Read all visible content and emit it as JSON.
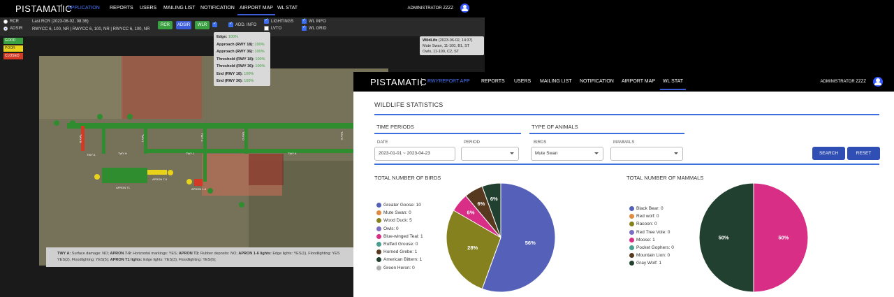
{
  "back_window": {
    "brand": "PISTAMATIC",
    "app_label": "APPLICATION",
    "nav": [
      "REPORTS",
      "USERS",
      "MAILING LIST",
      "NOTIFICATION",
      "AIRPORT MAP",
      "WL STAT"
    ],
    "active_nav": "AIRPORT MAP",
    "user": "ADMINISTRATOR ZZZZ",
    "controls": {
      "radio_rcr": "RCR",
      "radio_adsir": "ADSIR",
      "radio_selected": "ADSIR",
      "last_rcr": "Last RCR (2023-06-02, 08:36)",
      "rwycc": "RWYCC 6, 100, NR | RWYCC 6, 100, NR | RWYCC 6, 100, NR",
      "btn_rcr": "RCR",
      "btn_adsir": "ADSIR",
      "btn_wlr": "WLR",
      "add_info": "ADD. INFO",
      "lightings": "LIGHTINGS",
      "lvto": "LVTO",
      "wl_info": "WL INFO",
      "wl_grid": "WL GRID"
    },
    "legend": {
      "good": "GOOD",
      "poor": "POOR",
      "closed": "CLOSED"
    },
    "runway_popup": [
      {
        "label": "Edge:",
        "value": "100%"
      },
      {
        "label": "Approach (RWY 18):",
        "value": "100%"
      },
      {
        "label": "Approach (RWY 36):",
        "value": "100%"
      },
      {
        "label": "Threshold (RWY 18):",
        "value": "100%"
      },
      {
        "label": "Threshold (RWY 36):",
        "value": "100%"
      },
      {
        "label": "End (RWY 18):",
        "value": "100%"
      },
      {
        "label": "End (RWY 36):",
        "value": "100%"
      }
    ],
    "wildlife_popup": {
      "title": "WildLife",
      "date": "(2023-06-02, 14:37)",
      "line1": "Mute Swan, 11-100, B1, ST",
      "line2": "Owls, 11-100, C2, ST"
    },
    "map_labels": {
      "twy_a": "TWY A",
      "twy_b": "TWY B",
      "twy_c": "TWY C",
      "twy_d": "TWY D",
      "twy_e": "TWY E",
      "twy_h": "TWY H",
      "twy_i": "TWY I",
      "twy_j": "TWY J",
      "twy_k": "TWY K",
      "apron_t1": "APRON T1",
      "apron_79": "APRON 7-9",
      "apron_16": "APRON 1-6"
    },
    "twy_note": {
      "part1_b": "TWY A:",
      "part1": " Surface damage: NO; ",
      "part2_b": "APRON 7-9:",
      "part2": " Horizontal markings: YES; ",
      "part3_b": "APRON T1:",
      "part3": " Rubber deposits: NO; ",
      "part4_b": "APRON 1-6 lights:",
      "part4": " Edge lights: YES(1), Floodlighting: YES",
      "line2a": "YES(2), Floodlighting: YES(5); ",
      "line2b_b": "APRON T1 lights:",
      "line2b": " Edge lights: YES(3), Floodlighting: YES(6);"
    }
  },
  "front_window": {
    "brand": "PISTAMATIC",
    "app_label": "RWYREPORT APP",
    "nav": [
      "REPORTS",
      "USERS",
      "MAILING LIST",
      "NOTIFICATION",
      "AIRPORT MAP",
      "WL STAT"
    ],
    "active_nav": "WL STAT",
    "user": "ADMINISTRATOR ZZZZ",
    "page_title": "WILDLIFE STATISTICS",
    "time_periods": {
      "title": "TIME PERIODS",
      "date_label": "DATE",
      "date_value": "2023-01-01 ~ 2023-04-23",
      "period_label": "PERIOD",
      "period_value": ""
    },
    "animals": {
      "title": "TYPE OF ANIMALS",
      "birds_label": "BIRDS",
      "birds_value": "Mute Swan",
      "mammals_label": "MAMMALS",
      "mammals_value": ""
    },
    "search_button": "SEARCH",
    "reset_button": "RESET"
  },
  "chart_data": [
    {
      "type": "pie",
      "title": "TOTAL NUMBER OF BIRDS",
      "categories": [
        "Greater Goose",
        "Mute Swan",
        "Wood Duck",
        "Owls",
        "Blue-winged Teal",
        "Ruffed Grouse",
        "Horned Grebe",
        "American Bittern",
        "Green Heron"
      ],
      "values": [
        10,
        0,
        5,
        0,
        1,
        0,
        1,
        1,
        0
      ],
      "colors": [
        "#5560b8",
        "#e08a40",
        "#86811f",
        "#7d6cc4",
        "#d82e86",
        "#4a9e8f",
        "#57391f",
        "#22402f",
        "#b0b0b0"
      ],
      "labels": [
        "56%",
        "",
        "28%",
        "",
        "6%",
        "",
        "6%",
        "6%",
        ""
      ],
      "legend": "left"
    },
    {
      "type": "pie",
      "title": "TOTAL NUMBER OF MAMMALS",
      "categories": [
        "Black Bear",
        "Red wolf",
        "Racoon",
        "Red Tree Vole",
        "Moose",
        "Pocket Gophers",
        "Mountain Lion",
        "Gray Wolf"
      ],
      "values": [
        0,
        0,
        0,
        0,
        1,
        0,
        0,
        1
      ],
      "colors": [
        "#5560b8",
        "#e08a40",
        "#86811f",
        "#7d6cc4",
        "#d82e86",
        "#4a9e8f",
        "#57391f",
        "#22402f"
      ],
      "labels": [
        "",
        "",
        "",
        "",
        "50%",
        "",
        "",
        "50%"
      ],
      "legend": "left"
    }
  ]
}
